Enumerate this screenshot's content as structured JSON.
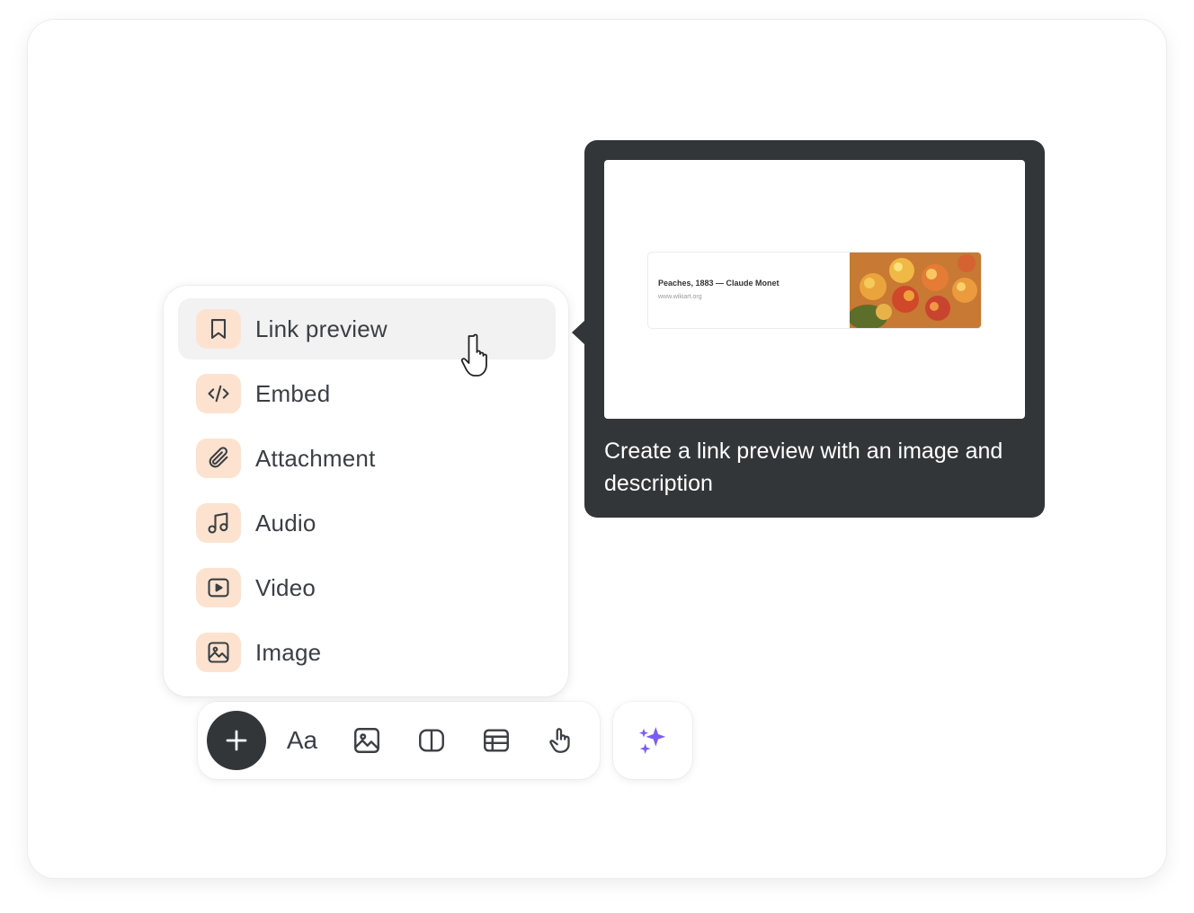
{
  "menu": {
    "items": [
      {
        "label": "Link preview",
        "icon": "bookmark-icon",
        "active": true
      },
      {
        "label": "Embed",
        "icon": "code-icon"
      },
      {
        "label": "Attachment",
        "icon": "paperclip-icon"
      },
      {
        "label": "Audio",
        "icon": "music-note-icon"
      },
      {
        "label": "Video",
        "icon": "play-icon"
      },
      {
        "label": "Image",
        "icon": "image-icon"
      }
    ]
  },
  "tooltip": {
    "description": "Create a link preview with an image and description",
    "preview": {
      "title": "Peaches, 1883 — Claude Monet",
      "url": "www.wikiart.org",
      "thumbnail_icon": "peaches-painting-thumbnail"
    }
  },
  "toolbar": {
    "add_icon": "plus-icon",
    "text_label": "Aa",
    "buttons": [
      "text-style-icon",
      "image-icon",
      "columns-icon",
      "table-icon",
      "pointer-hand-icon"
    ]
  },
  "ai_button": {
    "icon": "sparkles-icon"
  },
  "colors": {
    "icon_tile_bg": "#fde3cf",
    "tooltip_bg": "#333639",
    "active_item_bg": "#f2f2f2",
    "sparkle": "#7b5cf5"
  }
}
